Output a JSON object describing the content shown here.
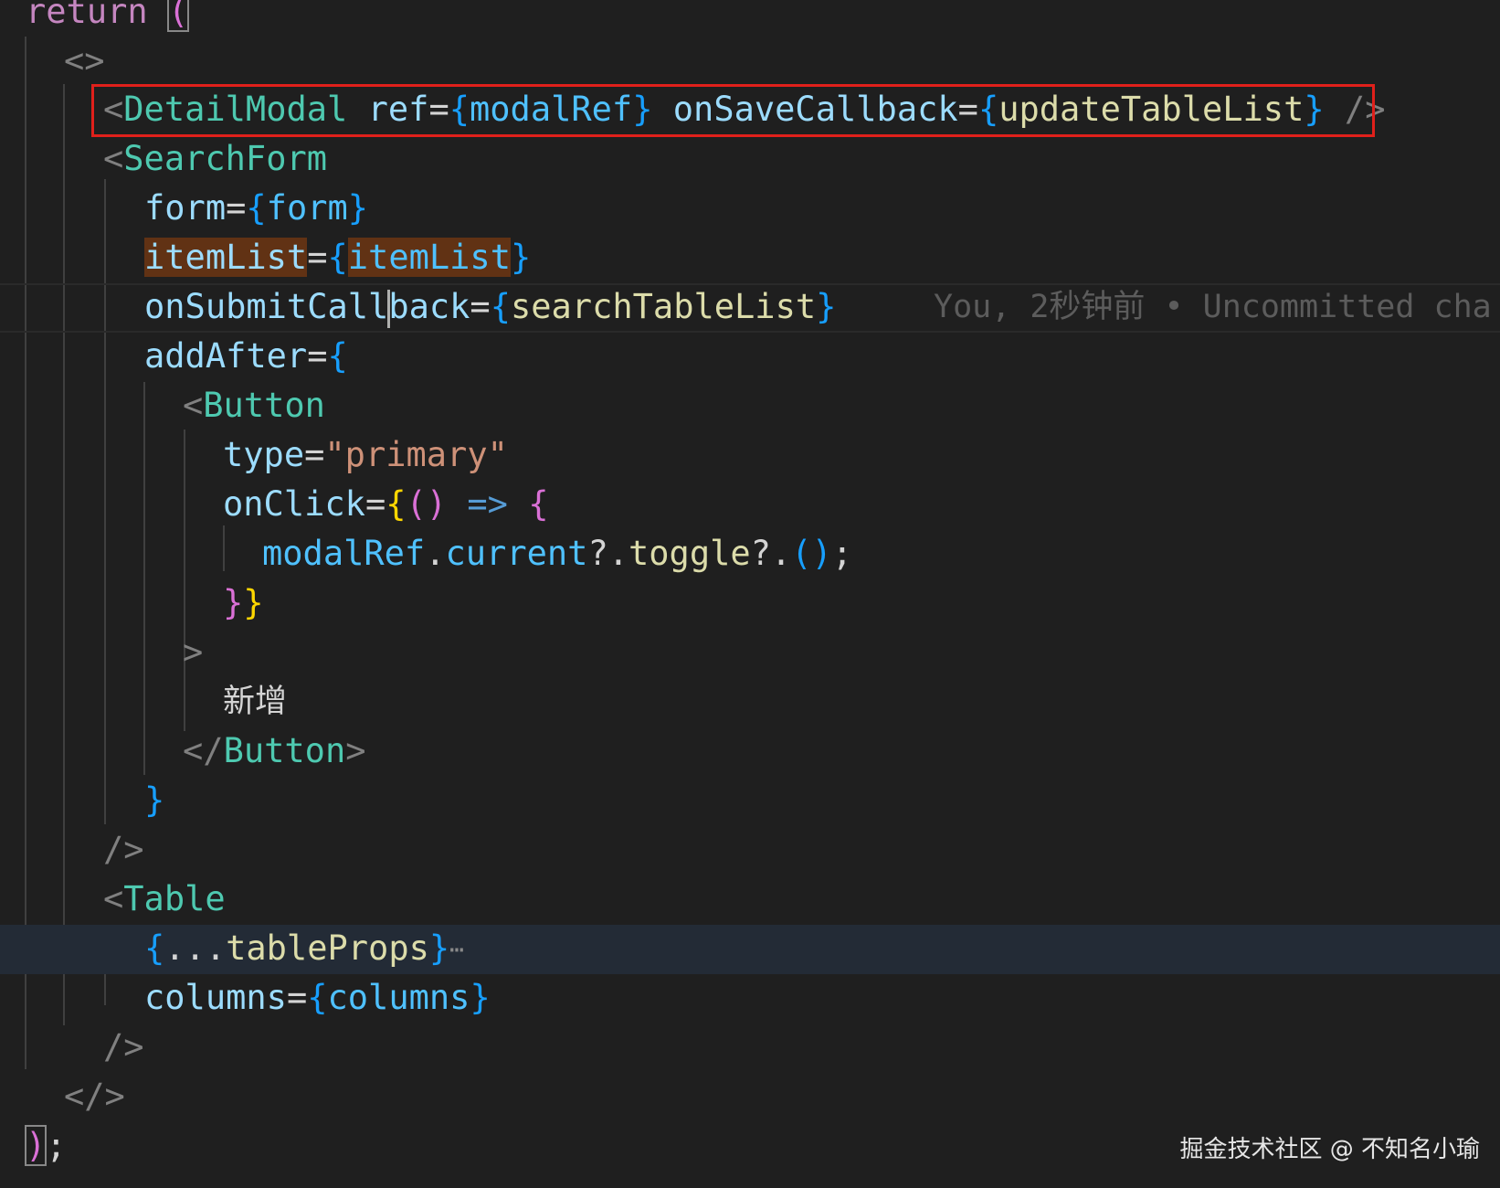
{
  "code": {
    "l0_return": "return",
    "l0_paren": "(",
    "l1_frag_open": "<>",
    "l2": {
      "lt": "<",
      "tag": "DetailModal",
      "attr1": "ref",
      "eq1": "=",
      "ob1": "{",
      "val1": "modalRef",
      "cb1": "}",
      "attr2": "onSaveCallback",
      "eq2": "=",
      "ob2": "{",
      "val2": "updateTableList",
      "cb2": "}",
      "close": "/>"
    },
    "l3": {
      "lt": "<",
      "tag": "SearchForm"
    },
    "l4": {
      "attr": "form",
      "eq": "=",
      "ob": "{",
      "val": "form",
      "cb": "}"
    },
    "l5": {
      "attr": "itemList",
      "eq": "=",
      "ob": "{",
      "val": "itemList",
      "cb": "}"
    },
    "l6": {
      "attr_a": "onSubmitCall",
      "attr_b": "back",
      "eq": "=",
      "ob": "{",
      "val": "searchTableList",
      "cb": "}"
    },
    "l7": {
      "attr": "addAfter",
      "eq": "=",
      "ob": "{"
    },
    "l8": {
      "lt": "<",
      "tag": "Button"
    },
    "l9": {
      "attr": "type",
      "eq": "=",
      "val": "\"primary\""
    },
    "l10": {
      "attr": "onClick",
      "eq": "=",
      "ob": "{",
      "params": "()",
      "arrow": "=>",
      "body_ob": "{"
    },
    "l11": {
      "obj": "modalRef",
      "dot1": ".",
      "prop": "current",
      "opt1": "?.",
      "fn": "toggle",
      "opt2": "?.",
      "call": "()",
      "semi": ";"
    },
    "l12": {
      "cb1": "}",
      "cb2": "}"
    },
    "l13": {
      "gt": ">"
    },
    "l14": {
      "text": "新增"
    },
    "l15": {
      "open": "</",
      "tag": "Button",
      "gt": ">"
    },
    "l16": {
      "cb": "}"
    },
    "l17": {
      "close": "/>"
    },
    "l18": {
      "lt": "<",
      "tag": "Table"
    },
    "l19": {
      "ob": "{",
      "spread": "...",
      "val": "tableProps",
      "cb": "}",
      "ellipsis": "⋯"
    },
    "l20": {
      "attr": "columns",
      "eq": "=",
      "ob": "{",
      "val": "columns",
      "cb": "}"
    },
    "l21": {
      "close": "/>"
    },
    "l22": {
      "frag_close": "</>"
    },
    "l23": {
      "paren": ")",
      "semi": ";"
    }
  },
  "blame": "You, 2秒钟前 • Uncommitted cha",
  "watermark": "掘金技术社区 @ 不知名小瑜",
  "colors": {
    "background": "#1f1f1f",
    "highlight_box": "#e0201b",
    "selection_highlight": "#613214",
    "folded_line_bg": "#232b36"
  }
}
